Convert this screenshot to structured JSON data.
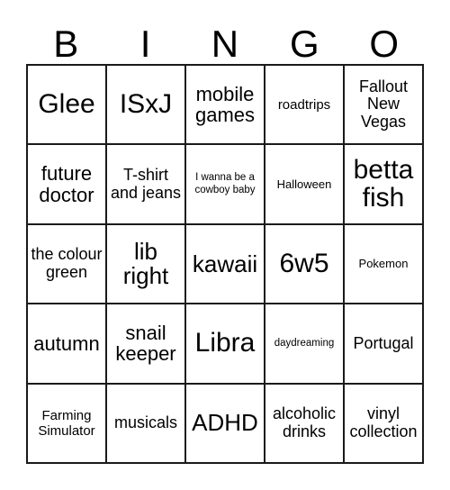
{
  "card": {
    "header_letters": [
      "B",
      "I",
      "N",
      "G",
      "O"
    ],
    "columns": 5,
    "rows": 5,
    "border_color": "#1a1a1a",
    "background_color": "#ffffff",
    "text_color": "#000000",
    "cells": [
      [
        {
          "text": "Glee",
          "size": "xxl"
        },
        {
          "text": "ISxJ",
          "size": "xxl"
        },
        {
          "text": "mobile games",
          "size": "lg"
        },
        {
          "text": "roadtrips",
          "size": "sm"
        },
        {
          "text": "Fallout New Vegas",
          "size": "md"
        }
      ],
      [
        {
          "text": "future doctor",
          "size": "lg"
        },
        {
          "text": "T-shirt and jeans",
          "size": "md"
        },
        {
          "text": "I wanna be a cowboy baby",
          "size": "xxs"
        },
        {
          "text": "Halloween",
          "size": "xs"
        },
        {
          "text": "betta fish",
          "size": "xxl"
        }
      ],
      [
        {
          "text": "the colour green",
          "size": "md"
        },
        {
          "text": "lib right",
          "size": "xl"
        },
        {
          "text": "kawaii",
          "size": "xl"
        },
        {
          "text": "6w5",
          "size": "xxl"
        },
        {
          "text": "Pokemon",
          "size": "xs"
        }
      ],
      [
        {
          "text": "autumn",
          "size": "lg"
        },
        {
          "text": "snail keeper",
          "size": "lg"
        },
        {
          "text": "Libra",
          "size": "xxl"
        },
        {
          "text": "daydreaming",
          "size": "xxs"
        },
        {
          "text": "Portugal",
          "size": "md"
        }
      ],
      [
        {
          "text": "Farming Simulator",
          "size": "sm"
        },
        {
          "text": "musicals",
          "size": "md"
        },
        {
          "text": "ADHD",
          "size": "xl"
        },
        {
          "text": "alcoholic drinks",
          "size": "md"
        },
        {
          "text": "vinyl collection",
          "size": "md"
        }
      ]
    ]
  }
}
